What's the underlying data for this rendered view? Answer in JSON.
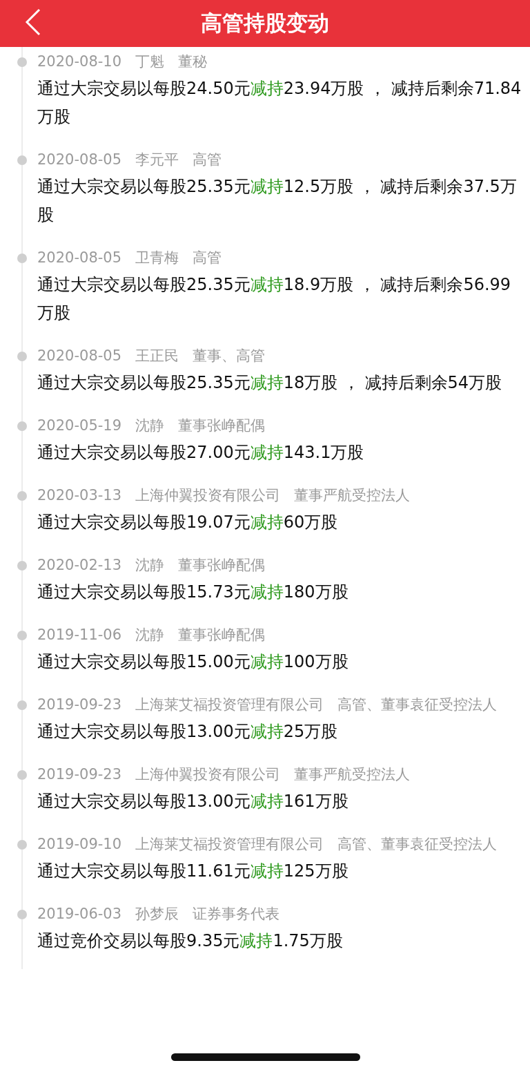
{
  "header": {
    "title": "高管持股变动"
  },
  "entries": [
    {
      "date": "2020-08-10",
      "name": "丁魁",
      "role": "董秘",
      "before": "通过大宗交易以每股24.50元",
      "action": "减持",
      "kind": "decrease",
      "after": "23.94万股 ， 减持后剩余71.84万股"
    },
    {
      "date": "2020-08-05",
      "name": "李元平",
      "role": "高管",
      "before": "通过大宗交易以每股25.35元",
      "action": "减持",
      "kind": "decrease",
      "after": "12.5万股 ， 减持后剩余37.5万股"
    },
    {
      "date": "2020-08-05",
      "name": "卫青梅",
      "role": "高管",
      "before": "通过大宗交易以每股25.35元",
      "action": "减持",
      "kind": "decrease",
      "after": "18.9万股 ， 减持后剩余56.99万股"
    },
    {
      "date": "2020-08-05",
      "name": "王正民",
      "role": "董事、高管",
      "before": "通过大宗交易以每股25.35元",
      "action": "减持",
      "kind": "decrease",
      "after": "18万股 ， 减持后剩余54万股"
    },
    {
      "date": "2020-05-19",
      "name": "沈静",
      "role": "董事张峥配偶",
      "before": "通过大宗交易以每股27.00元",
      "action": "减持",
      "kind": "decrease",
      "after": "143.1万股"
    },
    {
      "date": "2020-03-13",
      "name": "上海仲翼投资有限公司",
      "role": "董事严航受控法人",
      "before": "通过大宗交易以每股19.07元",
      "action": "减持",
      "kind": "decrease",
      "after": "60万股"
    },
    {
      "date": "2020-02-13",
      "name": "沈静",
      "role": "董事张峥配偶",
      "before": "通过大宗交易以每股15.73元",
      "action": "减持",
      "kind": "decrease",
      "after": "180万股"
    },
    {
      "date": "2019-11-06",
      "name": "沈静",
      "role": "董事张峥配偶",
      "before": "通过大宗交易以每股15.00元",
      "action": "减持",
      "kind": "decrease",
      "after": "100万股"
    },
    {
      "date": "2019-09-23",
      "name": "上海莱艾福投资管理有限公司",
      "role": "高管、董事袁征受控法人",
      "before": "通过大宗交易以每股13.00元",
      "action": "减持",
      "kind": "decrease",
      "after": "25万股"
    },
    {
      "date": "2019-09-23",
      "name": "上海仲翼投资有限公司",
      "role": "董事严航受控法人",
      "before": "通过大宗交易以每股13.00元",
      "action": "减持",
      "kind": "decrease",
      "after": "161万股"
    },
    {
      "date": "2019-09-10",
      "name": "上海莱艾福投资管理有限公司",
      "role": "高管、董事袁征受控法人",
      "before": "通过大宗交易以每股11.61元",
      "action": "减持",
      "kind": "decrease",
      "after": "125万股"
    },
    {
      "date": "2019-06-03",
      "name": "孙梦辰",
      "role": "证券事务代表",
      "before": "通过竞价交易以每股9.35元",
      "action": "减持",
      "kind": "decrease",
      "after": "1.75万股"
    }
  ]
}
